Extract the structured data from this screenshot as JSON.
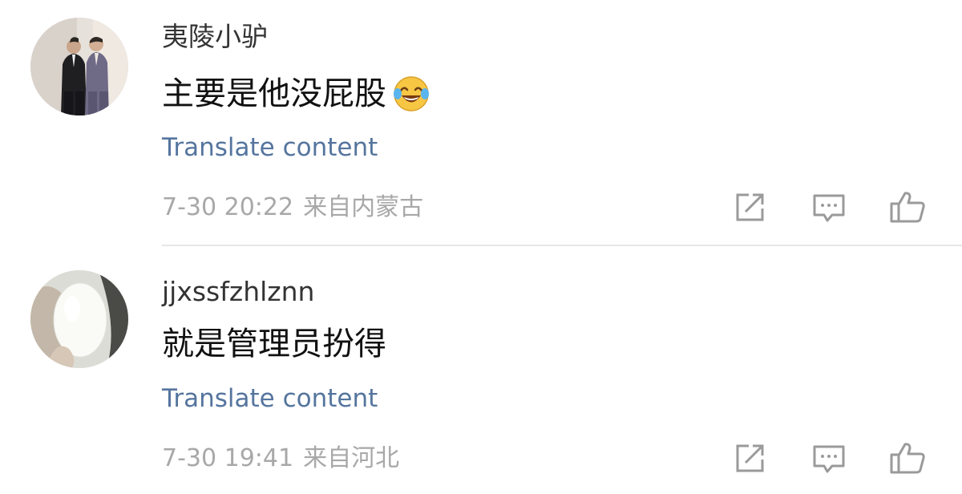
{
  "comments": [
    {
      "username": "夷陵小驴",
      "text": "主要是他没屁股",
      "emoji": "laughing-crying-emoji",
      "translate_label": "Translate content",
      "time": "7-30 20:22",
      "location": "来自内蒙古",
      "avatar": "two-men-in-suits-photo"
    },
    {
      "username": "jjxssfzhlznn",
      "text": "就是管理员扮得",
      "translate_label": "Translate content",
      "time": "7-30 19:41",
      "location": "来自河北",
      "avatar": "white-egg-photo"
    }
  ],
  "actions": {
    "share_icon": "share-icon",
    "comment_icon": "comment-icon",
    "like_icon": "thumbs-up-icon"
  },
  "colors": {
    "link": "#55759e",
    "meta": "#a8a8a8",
    "username": "#333333",
    "text": "#111111",
    "divider": "#e6e6e6"
  }
}
